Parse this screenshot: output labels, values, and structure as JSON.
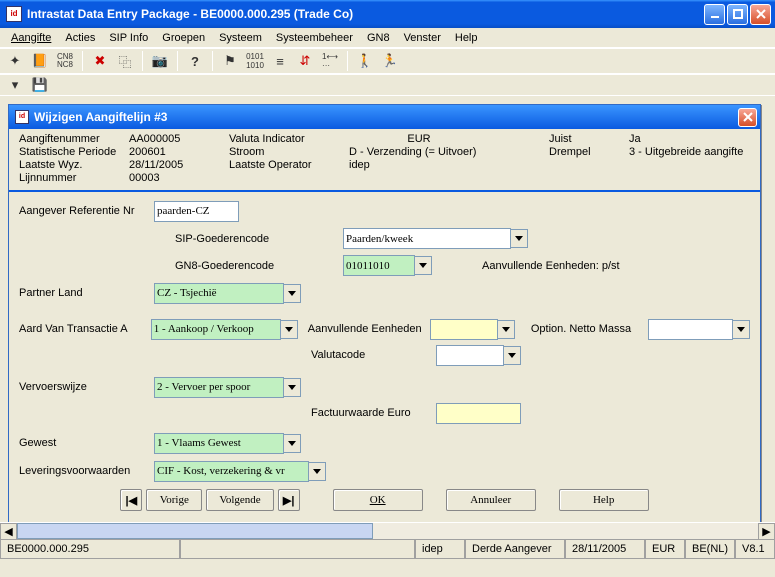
{
  "window": {
    "title": "Intrastat Data Entry Package - BE0000.000.295 (Trade Co)"
  },
  "menu": {
    "aangifte": "Aangifte",
    "acties": "Acties",
    "sipinfo": "SIP Info",
    "groepen": "Groepen",
    "systeem": "Systeem",
    "systeembeheer": "Systeembeheer",
    "gn8": "GN8",
    "venster": "Venster",
    "help": "Help"
  },
  "dialog": {
    "title": "Wijzigen Aangiftelijn #3"
  },
  "info": {
    "aangiftenummer_lbl": "Aangiftenummer",
    "aangiftenummer": "AA000005",
    "periode_lbl": "Statistische Periode",
    "periode": "200601",
    "laatste_wyz_lbl": "Laatste Wyz.",
    "laatste_wyz": "28/11/2005",
    "lijnnummer_lbl": "Lijnnummer",
    "lijnnummer": "00003",
    "valuta_ind_lbl": "Valuta Indicator",
    "valuta_ind": "EUR",
    "stroom_lbl": "Stroom",
    "stroom": "D - Verzending (= Uitvoer)",
    "operator_lbl": "Laatste Operator",
    "operator": "idep",
    "juist_lbl": "Juist",
    "juist": "Ja",
    "drempel_lbl": "Drempel",
    "drempel": "3 - Uitgebreide aangifte"
  },
  "form": {
    "ref_lbl": "Aangever Referentie Nr",
    "ref": "paarden-CZ",
    "sipgoed_lbl": "SIP-Goederencode",
    "sipgoed": "Paarden/kweek",
    "gn8goed_lbl": "GN8-Goederencode",
    "gn8goed": "01011010",
    "aanv_eenh_note": "Aanvullende Eenheden: p/st",
    "partner_lbl": "Partner Land",
    "partner": "CZ - Tsjechië",
    "aard_lbl": "Aard Van Transactie A",
    "aard": "1 - Aankoop / Verkoop",
    "aanv_eenh_lbl": "Aanvullende Eenheden",
    "aanv_eenh": "",
    "opt_netto_lbl": "Option. Netto Massa",
    "opt_netto": "",
    "valutacode_lbl": "Valutacode",
    "valutacode": "",
    "vervoer_lbl": "Vervoerswijze",
    "vervoer": "2 - Vervoer per spoor",
    "factuur_lbl": "Factuurwaarde Euro",
    "factuur": "",
    "gewest_lbl": "Gewest",
    "gewest": "1 - Vlaams Gewest",
    "levering_lbl": "Leveringsvoorwaarden",
    "levering": "CIF - Kost, verzekering & vr"
  },
  "buttons": {
    "vorige": "Vorige",
    "volgende": "Volgende",
    "ok": "OK",
    "annuleer": "Annuleer",
    "help": "Help"
  },
  "status": {
    "code": "BE0000.000.295",
    "user": "idep",
    "role": "Derde Aangever",
    "date": "28/11/2005",
    "cur": "EUR",
    "lang": "BE(NL)",
    "ver": "V8.1"
  }
}
